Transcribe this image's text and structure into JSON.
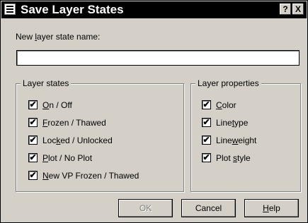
{
  "window": {
    "title": "Save Layer States",
    "help_glyph": "?",
    "close_glyph": "X"
  },
  "name_field": {
    "label_pre": "New ",
    "label_mnemonic": "l",
    "label_post": "ayer state name:",
    "value": ""
  },
  "layer_states": {
    "legend": "Layer states",
    "items": [
      {
        "pre": "",
        "mn": "O",
        "post": "n / Off",
        "checked": true
      },
      {
        "pre": "",
        "mn": "F",
        "post": "rozen / Thawed",
        "checked": true
      },
      {
        "pre": "Loc",
        "mn": "k",
        "post": "ed / Unlocked",
        "checked": true
      },
      {
        "pre": "",
        "mn": "P",
        "post": "lot / No Plot",
        "checked": true
      },
      {
        "pre": "",
        "mn": "N",
        "post": "ew VP Frozen / Thawed",
        "checked": true
      }
    ]
  },
  "layer_properties": {
    "legend": "Layer properties",
    "items": [
      {
        "pre": "",
        "mn": "C",
        "post": "olor",
        "checked": true
      },
      {
        "pre": "Line",
        "mn": "t",
        "post": "ype",
        "checked": true
      },
      {
        "pre": "Line",
        "mn": "w",
        "post": "eight",
        "checked": true
      },
      {
        "pre": "Plot ",
        "mn": "s",
        "post": "tyle",
        "checked": true
      }
    ]
  },
  "buttons": {
    "ok": "OK",
    "cancel": "Cancel",
    "help_mnemonic": "H",
    "help_rest": "elp"
  },
  "check_glyph": "✔"
}
